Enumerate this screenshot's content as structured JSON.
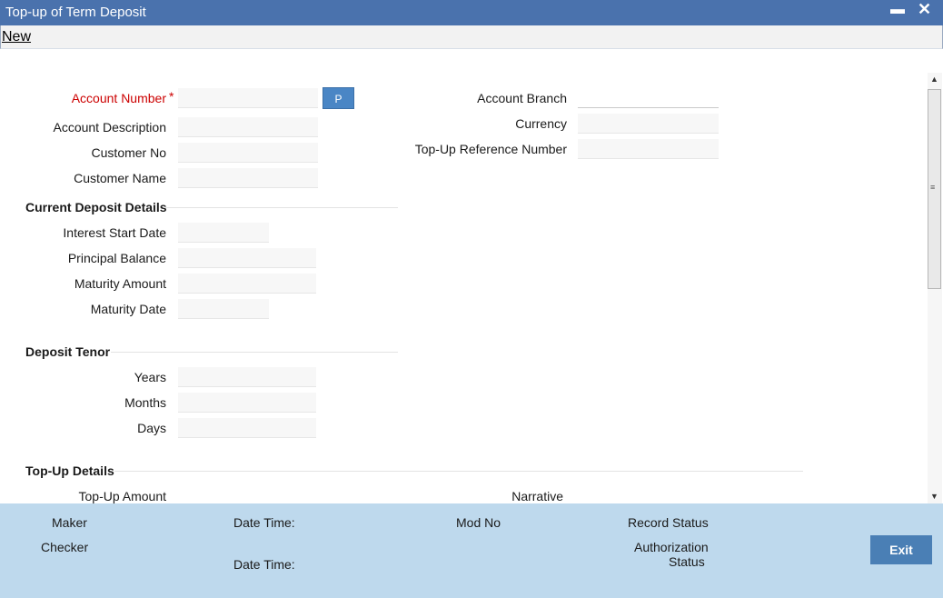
{
  "window": {
    "title": "Top-up of Term Deposit",
    "minimize_icon": "minimize-icon",
    "close_icon": "close-icon"
  },
  "menu": {
    "new_label": "New"
  },
  "form": {
    "account_number_label": "Account Number",
    "required_mark": "*",
    "p_button_label": "P",
    "account_description_label": "Account Description",
    "customer_no_label": "Customer No",
    "customer_name_label": "Customer Name",
    "account_branch_label": "Account Branch",
    "currency_label": "Currency",
    "topup_reference_label": "Top-Up Reference Number",
    "current_deposit_header": "Current Deposit Details",
    "interest_start_date_label": "Interest Start Date",
    "principal_balance_label": "Principal Balance",
    "maturity_amount_label": "Maturity Amount",
    "maturity_date_label": "Maturity Date",
    "deposit_tenor_header": "Deposit Tenor",
    "years_label": "Years",
    "months_label": "Months",
    "days_label": "Days",
    "topup_details_header": "Top-Up Details",
    "topup_amount_label": "Top-Up Amount",
    "narrative_label": "Narrative"
  },
  "footer": {
    "maker_label": "Maker",
    "checker_label": "Checker",
    "date_time_label_1": "Date Time:",
    "date_time_label_2": "Date Time:",
    "mod_no_label": "Mod No",
    "record_status_label": "Record Status",
    "authorization_status_line1": "Authorization",
    "authorization_status_line2": "Status",
    "exit_label": "Exit"
  },
  "colors": {
    "titlebar": "#4a72ad",
    "footer": "#bed9ed",
    "button": "#4a7fb5",
    "required": "#cc0000"
  }
}
